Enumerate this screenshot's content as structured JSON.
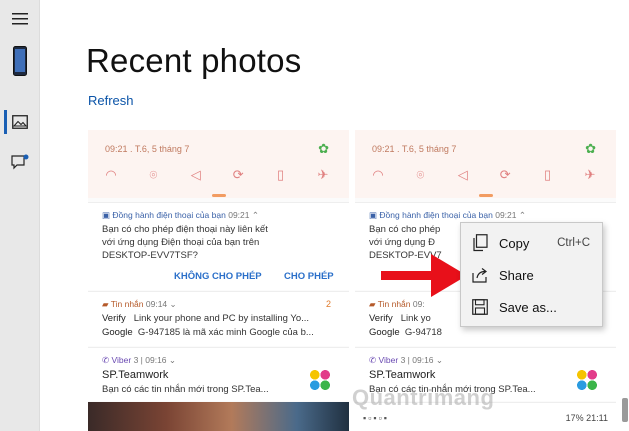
{
  "nav": {
    "items": [
      {
        "name": "menu",
        "icon": "hamburger-icon"
      },
      {
        "name": "phone",
        "icon": "phone-icon"
      },
      {
        "name": "photos",
        "icon": "photos-icon"
      },
      {
        "name": "messages",
        "icon": "message-icon"
      }
    ],
    "accent": "#1a5fb4"
  },
  "page": {
    "title": "Recent photos",
    "refresh_label": "Refresh"
  },
  "card_left": {
    "time": "09:21 . T.6, 5 tháng 7",
    "notif1": {
      "app": "Đồng hành điện thoại của bạn",
      "time": "09:21",
      "line1": "Bạn có cho phép điện thoại này liên kết",
      "line2": "với ứng dụng Điện thoại của bạn trên",
      "line3": "DESKTOP-EVV7TSF?",
      "deny": "KHÔNG CHO PHÉP",
      "allow": "CHO PHÉP"
    },
    "notif2": {
      "app": "Tin nhắn",
      "time": "09:14",
      "count": "2",
      "line1_bold": "Verify",
      "line1": "Link your phone and PC by installing Yo...",
      "line2_bold": "Google",
      "line2": "G-947185 là mã xác minh Google của b..."
    },
    "notif3": {
      "app": "Viber",
      "count": "3",
      "time": "09:16",
      "name": "SP.Teamwork",
      "text": "Bạn có các tin nhắn mới trong SP.Tea..."
    }
  },
  "card_right": {
    "time": "09:21 . T.6, 5 tháng 7",
    "notif1": {
      "app": "Đồng hành điện thoại của bạn",
      "time": "09:21",
      "line1": "Bạn có cho phép",
      "line2": "với ứng dụng Đ",
      "line3": "DESKTOP-EVV7"
    },
    "notif2": {
      "app": "Tin nhắn",
      "time": "09:",
      "line1_bold": "Verify",
      "line1": "Link yo",
      "line2_bold": "Google",
      "line2": "G-94718"
    },
    "notif3": {
      "app": "Viber",
      "count": "3",
      "time": "09:16",
      "name": "SP.Teamwork",
      "text": "Bạn có các tin nhắn mới trong SP.Tea..."
    },
    "status_right": "17% 21:11"
  },
  "context_menu": {
    "items": [
      {
        "label": "Copy",
        "shortcut": "Ctrl+C",
        "icon": "copy-icon"
      },
      {
        "label": "Share",
        "shortcut": "",
        "icon": "share-icon"
      },
      {
        "label": "Save as...",
        "shortcut": "",
        "icon": "save-icon"
      }
    ]
  },
  "watermark": "Quantrimang",
  "colors": {
    "arrow": "#e8101a",
    "link": "#0b54a8",
    "action": "#2a6fc9"
  }
}
